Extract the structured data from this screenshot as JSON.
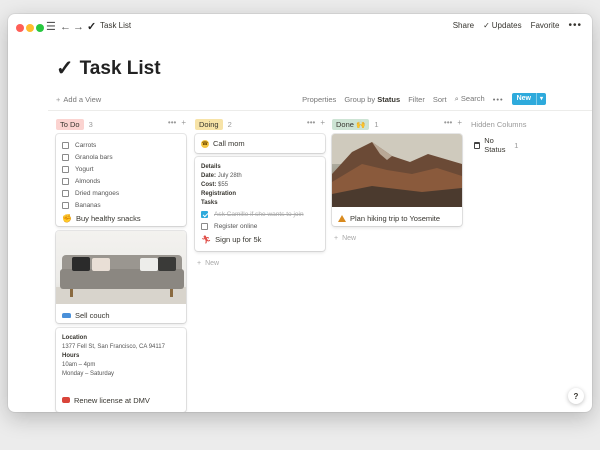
{
  "window": {
    "title": "Task List",
    "actions": {
      "share": "Share",
      "updates": "Updates",
      "favorite": "Favorite",
      "more": "•••"
    }
  },
  "page": {
    "title": "Task List"
  },
  "toolbar": {
    "add_view": "Add a View",
    "properties": "Properties",
    "group_by_prefix": "Group by",
    "group_by_value": "Status",
    "filter": "Filter",
    "sort": "Sort",
    "search": "Search",
    "more": "•••",
    "new_label": "New"
  },
  "colors": {
    "todo_tag": "#fbd3d0",
    "doing_tag": "#f7e3a7",
    "done_tag": "#cde4d4",
    "accent": "#2eaadc"
  },
  "columns": {
    "todo": {
      "label": "To Do",
      "count": "3",
      "cards": {
        "snacks": {
          "checklist": [
            "Carrots",
            "Granola bars",
            "Yogurt",
            "Almonds",
            "Dried mangoes",
            "Bananas"
          ],
          "title": "Buy healthy snacks",
          "icon": "hand-icon"
        },
        "couch": {
          "title": "Sell couch",
          "icon": "couch-icon"
        },
        "dmv": {
          "location_label": "Location",
          "location_value": "1377 Fell St, San Francisco, CA 94117",
          "hours_label": "Hours",
          "hours_1": "10am – 4pm",
          "hours_2": "Monday – Saturday",
          "title": "Renew license at DMV",
          "icon": "car-icon"
        }
      }
    },
    "doing": {
      "label": "Doing",
      "count": "2",
      "cards": {
        "call": {
          "title": "Call mom",
          "icon": "phone-icon"
        },
        "run": {
          "details_label": "Details",
          "date_label": "Date:",
          "date_value": "July 28th",
          "cost_label": "Cost:",
          "cost_value": "$55",
          "registration_label": "Registration",
          "tasks_label": "Tasks",
          "task_1": "Ask Camille if she wants to join",
          "task_1_done": true,
          "task_2": "Register online",
          "task_2_done": false,
          "title": "Sign up for 5k",
          "icon": "runner-icon"
        }
      },
      "new_label": "New"
    },
    "done": {
      "label": "Done 🙌",
      "count": "1",
      "cards": {
        "hike": {
          "title": "Plan hiking trip to Yosemite",
          "icon": "tent-icon"
        }
      },
      "new_label": "New"
    },
    "hidden": {
      "label": "Hidden Columns",
      "no_status_label": "No Status",
      "no_status_count": "1"
    }
  },
  "help_label": "?"
}
